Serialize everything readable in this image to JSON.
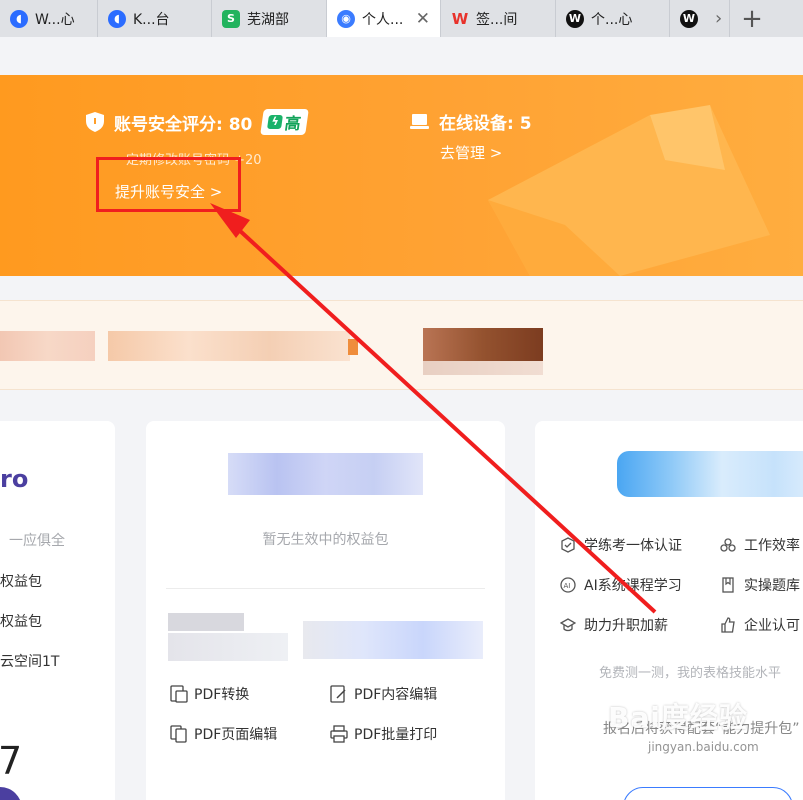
{
  "tabs": [
    {
      "label": "W...心",
      "icon": "kdocs-icon",
      "color": "#2b6cff"
    },
    {
      "label": "K...台",
      "icon": "kdocs-icon",
      "color": "#2b6cff"
    },
    {
      "label": "芜湖部",
      "icon": "sheet-s-icon",
      "color": "#22b35e"
    },
    {
      "label": "个人...",
      "icon": "user-icon",
      "color": "#3b7cff",
      "active": true
    },
    {
      "label": "签...间",
      "icon": "wps-icon",
      "color": "#e8322b"
    },
    {
      "label": "个...心",
      "icon": "wps-w-icon",
      "color": "#111111"
    },
    {
      "label": "",
      "icon": "wps-w-icon",
      "color": "#111111"
    }
  ],
  "banner": {
    "score_label": "账号安全评分: 80",
    "level": "高",
    "tip": "定期修改账号密码 +20",
    "improve": "提升账号安全 >",
    "devices_label": "在线设备: 5",
    "manage": "去管理 >"
  },
  "card1": {
    "pro": "ro",
    "lines": [
      "一应俱全",
      "权益包",
      "权益包",
      "云空间1T"
    ],
    "number": "7"
  },
  "card2": {
    "empty": "暂无生效中的权益包",
    "tools": [
      "PDF转换",
      "PDF内容编辑",
      "PDF页面编辑",
      "PDF批量打印"
    ]
  },
  "card3": {
    "features": [
      "学练考一体认证",
      "工作效率",
      "AI系统课程学习",
      "实操题库",
      "助力升职加薪",
      "企业认可"
    ],
    "test": "免费测一测，我的表格技能水平",
    "enroll": "报名后将获得配套“能力提升包”"
  },
  "watermark": {
    "main": "Bai度经验",
    "sub": "jingyan.baidu.com"
  },
  "colors": {
    "accent": "#ff9f2a",
    "highlight": "#f01e1e",
    "brand": "#4b3fa0"
  }
}
